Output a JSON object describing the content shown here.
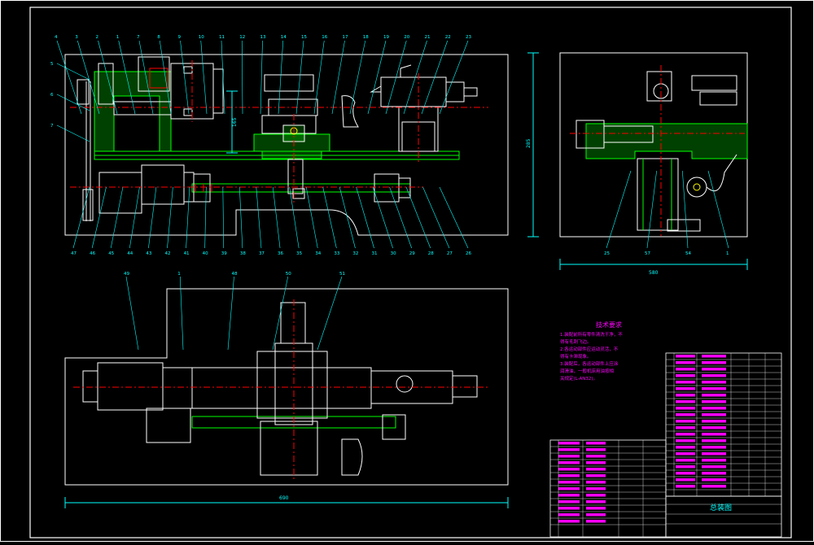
{
  "colors": {
    "background": "#000000",
    "frame": "#ffffff",
    "outline": "#ffffff",
    "part": "#00ff00",
    "hatch": "#00ff00",
    "center": "#ff0000",
    "leader": "#00ffff",
    "text_cyan": "#00ffff",
    "text_magenta": "#ff00ff",
    "table_border": "#ffffff",
    "highlight": "#ffff00"
  },
  "front_view": {
    "callouts_top": [
      "4",
      "3",
      "2",
      "1",
      "7",
      "8",
      "9",
      "10",
      "11",
      "12",
      "13",
      "14",
      "15",
      "16",
      "17",
      "18",
      "19",
      "20",
      "21",
      "22",
      "23"
    ],
    "callouts_left": [
      "5",
      "6",
      "7"
    ],
    "callouts_bottom": [
      "47",
      "46",
      "45",
      "44",
      "43",
      "42",
      "41",
      "40",
      "39",
      "38",
      "37",
      "36",
      "35",
      "34",
      "33",
      "32",
      "31",
      "30",
      "29",
      "28",
      "27",
      "26"
    ],
    "dimension_height": "165"
  },
  "side_view": {
    "callouts_bottom": [
      "25",
      "57",
      "54",
      "1"
    ],
    "dimension_width": "580",
    "dimension_height": "285"
  },
  "top_view": {
    "callouts_top": [
      "49",
      "1",
      "48",
      "50",
      "51"
    ],
    "dimension_width": "690"
  },
  "technical_notes": {
    "title": "技术要求",
    "lines": [
      "1.装配前所有零件清洗干净，不",
      "  得有毛刺飞边。",
      "2.各运动部件应运动灵活，不",
      "  得有卡滞现象。",
      "3.装配后，各运动部件上应涂",
      "  润滑油，一般机床用油按相",
      "  关规定(L-AN32)。"
    ]
  },
  "title_block": {
    "drawing_title": "总装图"
  }
}
